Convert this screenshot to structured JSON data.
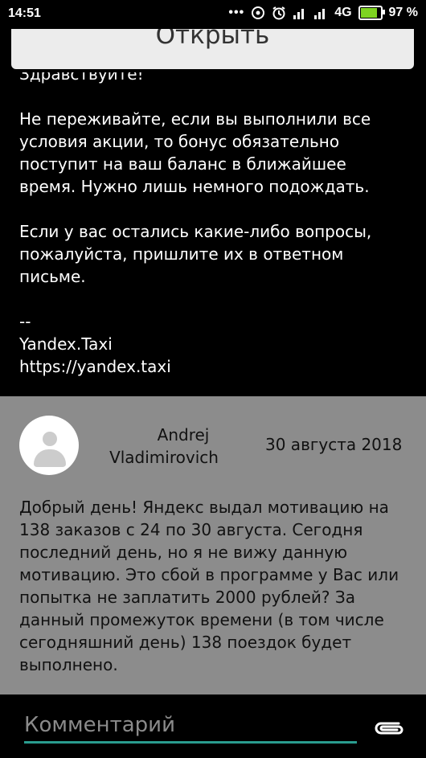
{
  "status_bar": {
    "time": "14:51",
    "dots": "•••",
    "network": "4G",
    "battery": "97 %"
  },
  "open_button": {
    "label": "Открыть"
  },
  "message": {
    "greeting": "Здравствуйте!",
    "paragraph1": "Не переживайте, если вы выполнили все условия акции, то бонус обязательно поступит на ваш баланс в ближайшее время. Нужно лишь немного подождать.",
    "paragraph2": "Если у вас остались какие-либо вопросы, пожалуйста, пришлите их в ответном письме.",
    "signature_sep": "--",
    "signature_name": "Yandex.Taxi",
    "signature_url": "https://yandex.taxi"
  },
  "comment": {
    "author_first": "Andrej",
    "author_last": "Vladimirovich",
    "date": "30 августа 2018",
    "text": "Добрый день! Яндекс выдал мотивацию на 138 заказов с 24 по 30 августа. Сегодня последний день, но я не вижу данную мотивацию. Это сбой в программе у Вас или попытка не заплатить 2000 рублей? За данный промежуток времени (в том числе сегодняшний день) 138 поездок будет выполнено."
  },
  "comment_input": {
    "placeholder": "Комментарий"
  },
  "colors": {
    "accent": "#2a9d8f",
    "card_bg": "#8c8c8c",
    "battery_fill": "#7ed321"
  }
}
